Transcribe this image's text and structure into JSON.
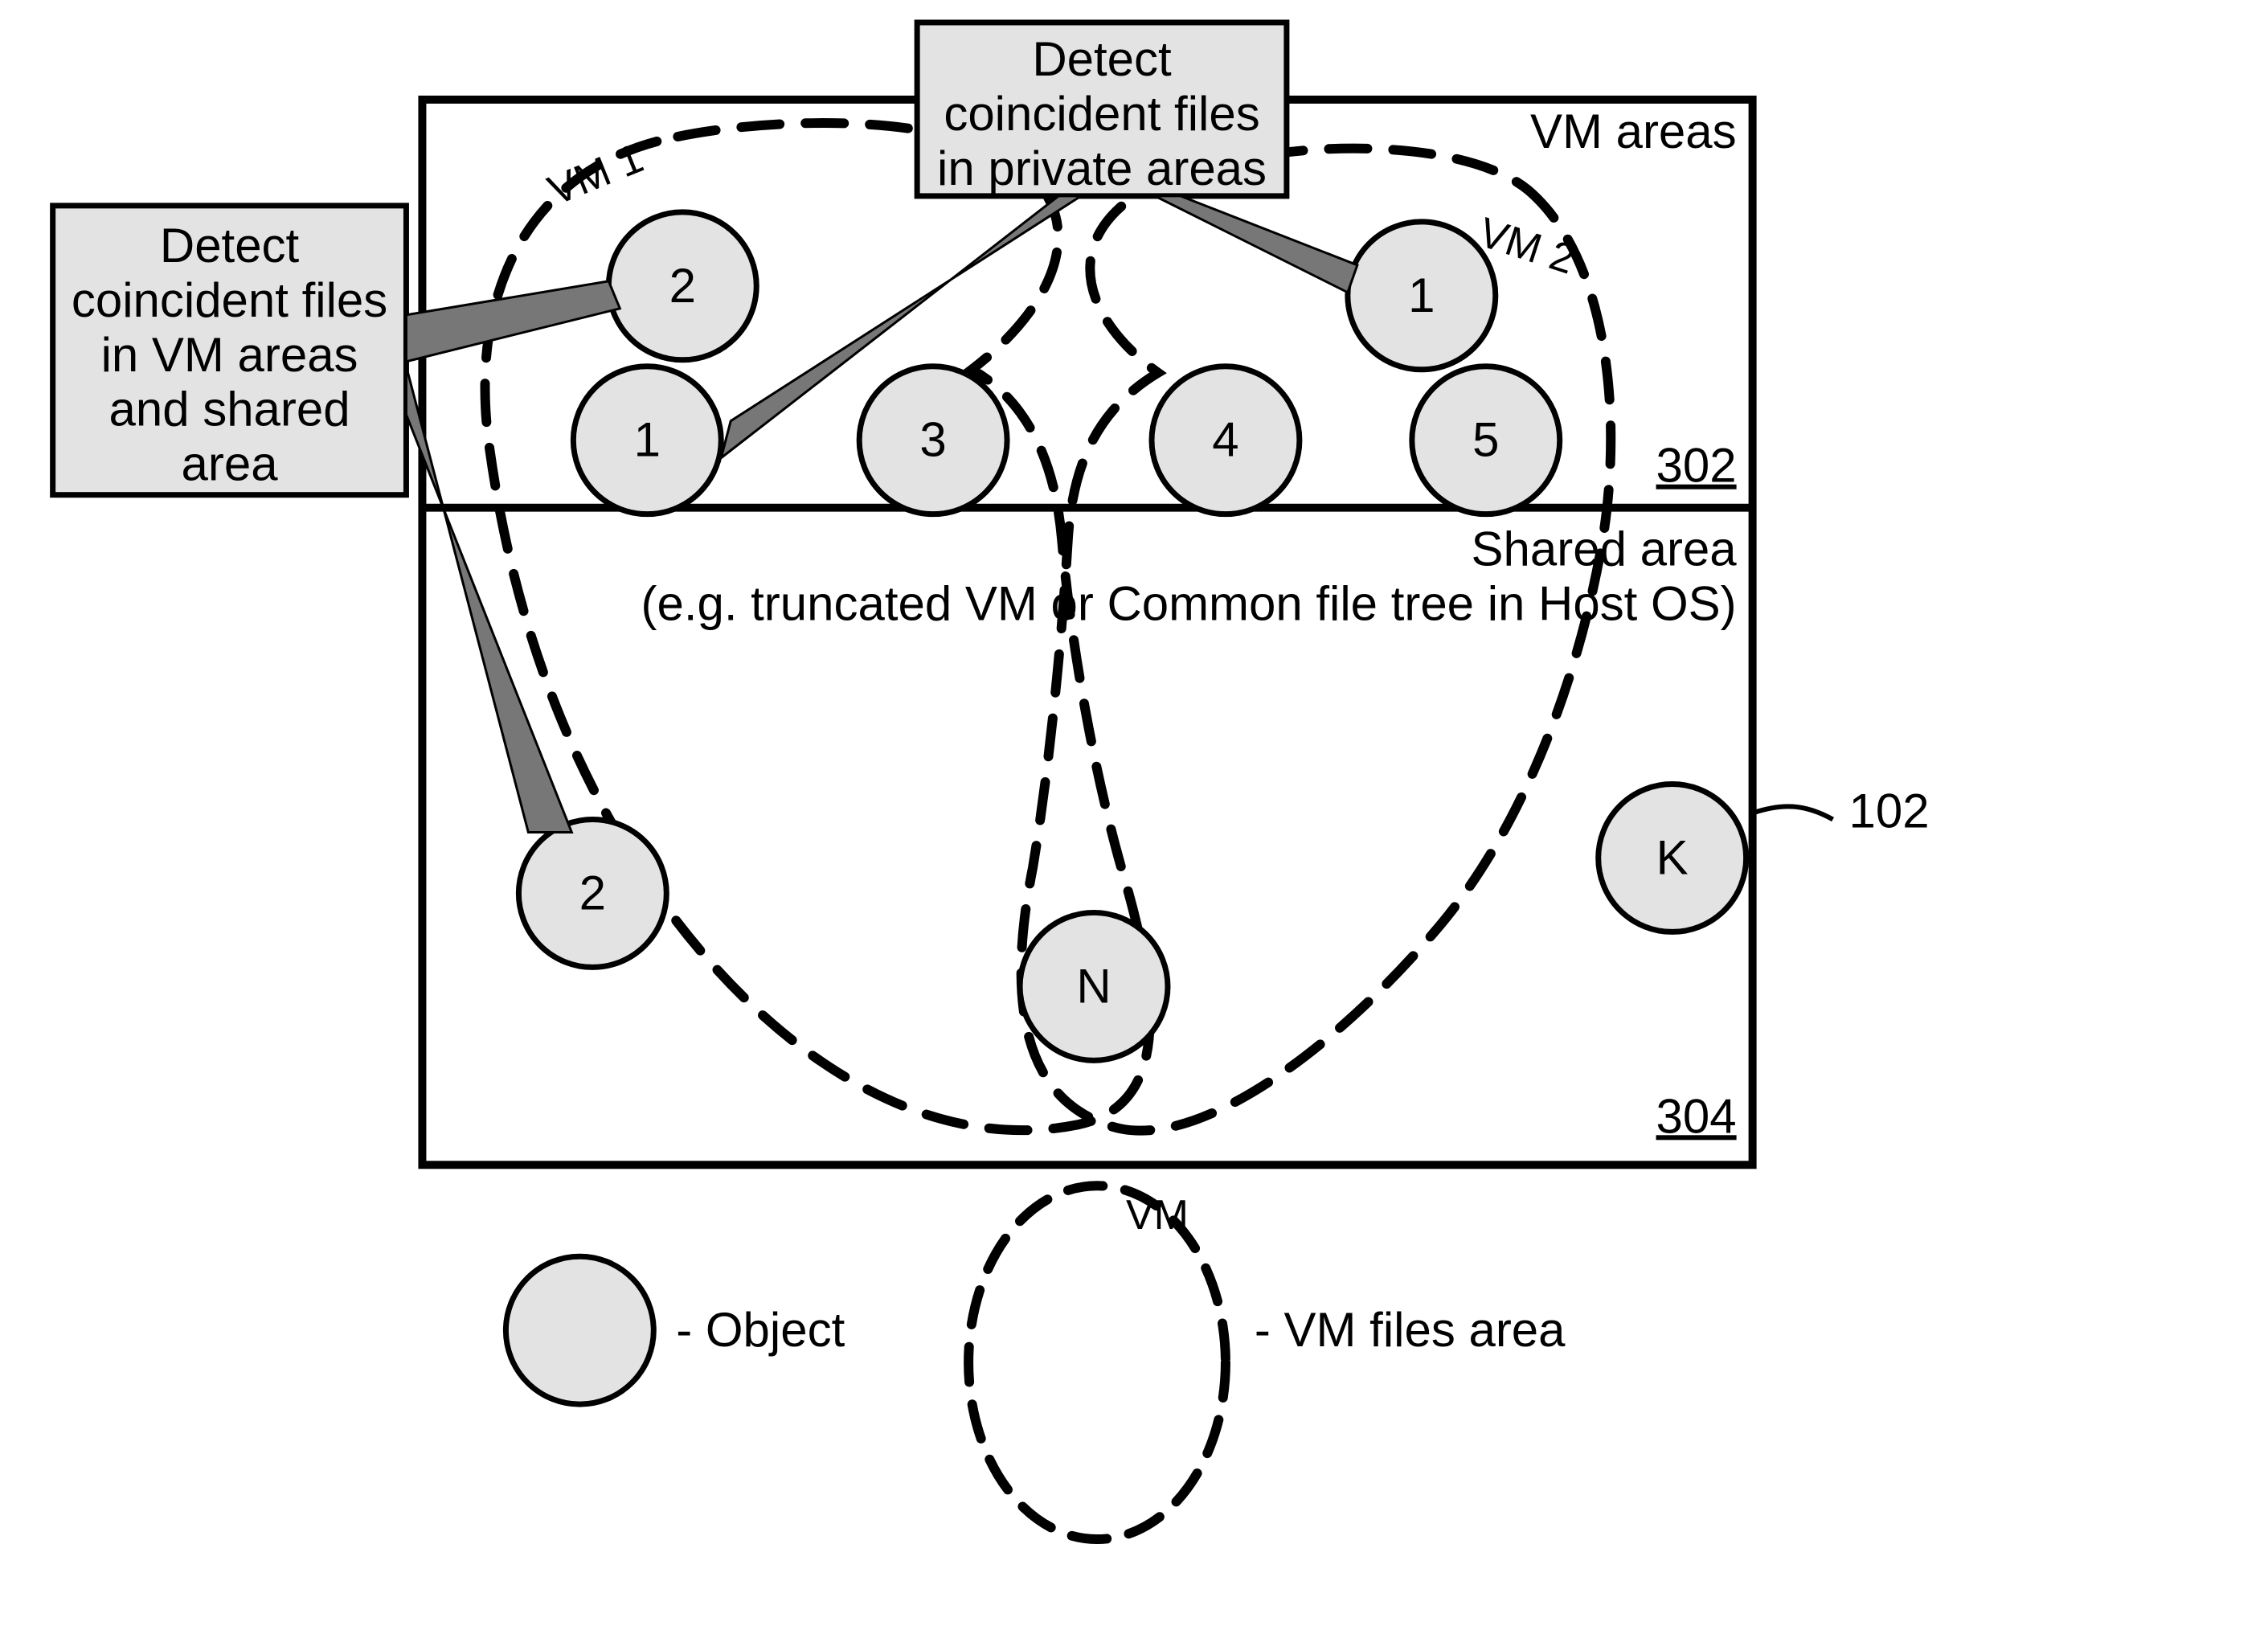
{
  "areas": {
    "vm_areas_label": "VM areas",
    "vm_areas_ref": "302",
    "shared_label_line1": "Shared area",
    "shared_label_line2": "(e.g. truncated VM or Common file tree in Host OS)",
    "shared_ref": "304"
  },
  "vms": {
    "vm1_label": "VM 1",
    "vm2_label": "VM 2"
  },
  "objects": {
    "vm1_top": "2",
    "vm1_bottom": "1",
    "mid3": "3",
    "mid4": "4",
    "vm2_top": "1",
    "vm2_bottom": "5",
    "shared_left": "2",
    "shared_center": "N",
    "shared_right": "K"
  },
  "callouts": {
    "top_line1": "Detect",
    "top_line2": "coincident files",
    "top_line3": "in private areas",
    "left_line1": "Detect",
    "left_line2": "coincident files",
    "left_line3": "in VM areas",
    "left_line4": "and shared",
    "left_line5": "area"
  },
  "legend": {
    "object_label": "Object",
    "vm_icon_label": "VM",
    "vm_files_label": "VM files area",
    "dash": "- "
  },
  "outer_ref": "102"
}
